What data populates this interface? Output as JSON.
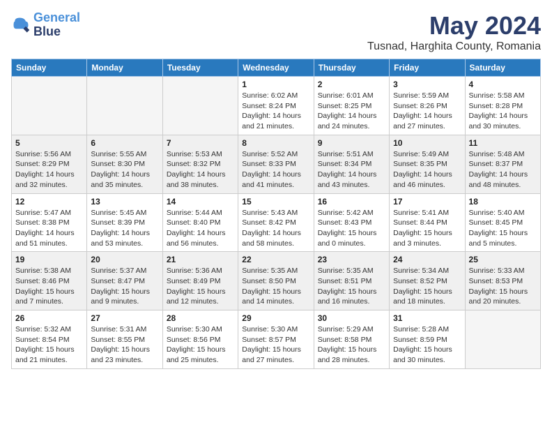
{
  "header": {
    "logo_line1": "General",
    "logo_line2": "Blue",
    "month_title": "May 2024",
    "location": "Tusnad, Harghita County, Romania"
  },
  "weekdays": [
    "Sunday",
    "Monday",
    "Tuesday",
    "Wednesday",
    "Thursday",
    "Friday",
    "Saturday"
  ],
  "weeks": [
    [
      {
        "day": "",
        "info": ""
      },
      {
        "day": "",
        "info": ""
      },
      {
        "day": "",
        "info": ""
      },
      {
        "day": "1",
        "info": "Sunrise: 6:02 AM\nSunset: 8:24 PM\nDaylight: 14 hours\nand 21 minutes."
      },
      {
        "day": "2",
        "info": "Sunrise: 6:01 AM\nSunset: 8:25 PM\nDaylight: 14 hours\nand 24 minutes."
      },
      {
        "day": "3",
        "info": "Sunrise: 5:59 AM\nSunset: 8:26 PM\nDaylight: 14 hours\nand 27 minutes."
      },
      {
        "day": "4",
        "info": "Sunrise: 5:58 AM\nSunset: 8:28 PM\nDaylight: 14 hours\nand 30 minutes."
      }
    ],
    [
      {
        "day": "5",
        "info": "Sunrise: 5:56 AM\nSunset: 8:29 PM\nDaylight: 14 hours\nand 32 minutes."
      },
      {
        "day": "6",
        "info": "Sunrise: 5:55 AM\nSunset: 8:30 PM\nDaylight: 14 hours\nand 35 minutes."
      },
      {
        "day": "7",
        "info": "Sunrise: 5:53 AM\nSunset: 8:32 PM\nDaylight: 14 hours\nand 38 minutes."
      },
      {
        "day": "8",
        "info": "Sunrise: 5:52 AM\nSunset: 8:33 PM\nDaylight: 14 hours\nand 41 minutes."
      },
      {
        "day": "9",
        "info": "Sunrise: 5:51 AM\nSunset: 8:34 PM\nDaylight: 14 hours\nand 43 minutes."
      },
      {
        "day": "10",
        "info": "Sunrise: 5:49 AM\nSunset: 8:35 PM\nDaylight: 14 hours\nand 46 minutes."
      },
      {
        "day": "11",
        "info": "Sunrise: 5:48 AM\nSunset: 8:37 PM\nDaylight: 14 hours\nand 48 minutes."
      }
    ],
    [
      {
        "day": "12",
        "info": "Sunrise: 5:47 AM\nSunset: 8:38 PM\nDaylight: 14 hours\nand 51 minutes."
      },
      {
        "day": "13",
        "info": "Sunrise: 5:45 AM\nSunset: 8:39 PM\nDaylight: 14 hours\nand 53 minutes."
      },
      {
        "day": "14",
        "info": "Sunrise: 5:44 AM\nSunset: 8:40 PM\nDaylight: 14 hours\nand 56 minutes."
      },
      {
        "day": "15",
        "info": "Sunrise: 5:43 AM\nSunset: 8:42 PM\nDaylight: 14 hours\nand 58 minutes."
      },
      {
        "day": "16",
        "info": "Sunrise: 5:42 AM\nSunset: 8:43 PM\nDaylight: 15 hours\nand 0 minutes."
      },
      {
        "day": "17",
        "info": "Sunrise: 5:41 AM\nSunset: 8:44 PM\nDaylight: 15 hours\nand 3 minutes."
      },
      {
        "day": "18",
        "info": "Sunrise: 5:40 AM\nSunset: 8:45 PM\nDaylight: 15 hours\nand 5 minutes."
      }
    ],
    [
      {
        "day": "19",
        "info": "Sunrise: 5:38 AM\nSunset: 8:46 PM\nDaylight: 15 hours\nand 7 minutes."
      },
      {
        "day": "20",
        "info": "Sunrise: 5:37 AM\nSunset: 8:47 PM\nDaylight: 15 hours\nand 9 minutes."
      },
      {
        "day": "21",
        "info": "Sunrise: 5:36 AM\nSunset: 8:49 PM\nDaylight: 15 hours\nand 12 minutes."
      },
      {
        "day": "22",
        "info": "Sunrise: 5:35 AM\nSunset: 8:50 PM\nDaylight: 15 hours\nand 14 minutes."
      },
      {
        "day": "23",
        "info": "Sunrise: 5:35 AM\nSunset: 8:51 PM\nDaylight: 15 hours\nand 16 minutes."
      },
      {
        "day": "24",
        "info": "Sunrise: 5:34 AM\nSunset: 8:52 PM\nDaylight: 15 hours\nand 18 minutes."
      },
      {
        "day": "25",
        "info": "Sunrise: 5:33 AM\nSunset: 8:53 PM\nDaylight: 15 hours\nand 20 minutes."
      }
    ],
    [
      {
        "day": "26",
        "info": "Sunrise: 5:32 AM\nSunset: 8:54 PM\nDaylight: 15 hours\nand 21 minutes."
      },
      {
        "day": "27",
        "info": "Sunrise: 5:31 AM\nSunset: 8:55 PM\nDaylight: 15 hours\nand 23 minutes."
      },
      {
        "day": "28",
        "info": "Sunrise: 5:30 AM\nSunset: 8:56 PM\nDaylight: 15 hours\nand 25 minutes."
      },
      {
        "day": "29",
        "info": "Sunrise: 5:30 AM\nSunset: 8:57 PM\nDaylight: 15 hours\nand 27 minutes."
      },
      {
        "day": "30",
        "info": "Sunrise: 5:29 AM\nSunset: 8:58 PM\nDaylight: 15 hours\nand 28 minutes."
      },
      {
        "day": "31",
        "info": "Sunrise: 5:28 AM\nSunset: 8:59 PM\nDaylight: 15 hours\nand 30 minutes."
      },
      {
        "day": "",
        "info": ""
      }
    ]
  ]
}
